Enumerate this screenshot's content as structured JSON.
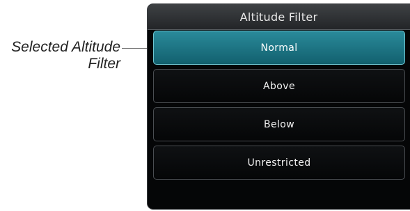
{
  "callout": {
    "line1": "Selected Altitude",
    "line2": "Filter"
  },
  "window": {
    "title": "Altitude Filter"
  },
  "filters": [
    {
      "label": "Normal",
      "selected": true
    },
    {
      "label": "Above",
      "selected": false
    },
    {
      "label": "Below",
      "selected": false
    },
    {
      "label": "Unrestricted",
      "selected": false
    }
  ],
  "colors": {
    "selected": "#1c7886",
    "background": "#050607",
    "title_bar": "#2e3134"
  }
}
